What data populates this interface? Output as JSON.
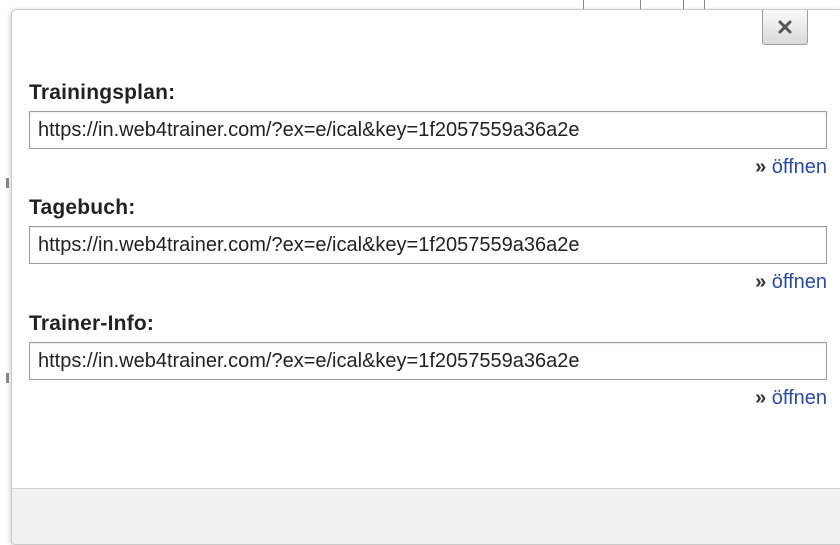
{
  "dialog": {
    "close_symbol": "×",
    "sections": [
      {
        "label": "Trainingsplan:",
        "url": "https://in.web4trainer.com/?ex=e/ical&key=1f2057559a36a2e",
        "link_prefix": "»",
        "link_label": "öffnen"
      },
      {
        "label": "Tagebuch:",
        "url": "https://in.web4trainer.com/?ex=e/ical&key=1f2057559a36a2e",
        "link_prefix": "»",
        "link_label": "öffnen"
      },
      {
        "label": "Trainer-Info:",
        "url": "https://in.web4trainer.com/?ex=e/ical&key=1f2057559a36a2e",
        "link_prefix": "»",
        "link_label": "öffnen"
      }
    ]
  },
  "colors": {
    "link": "#2b4aa5",
    "label_text": "#222222",
    "footer_bg": "#f1f1f1"
  },
  "icons": {
    "close": "close-icon"
  }
}
